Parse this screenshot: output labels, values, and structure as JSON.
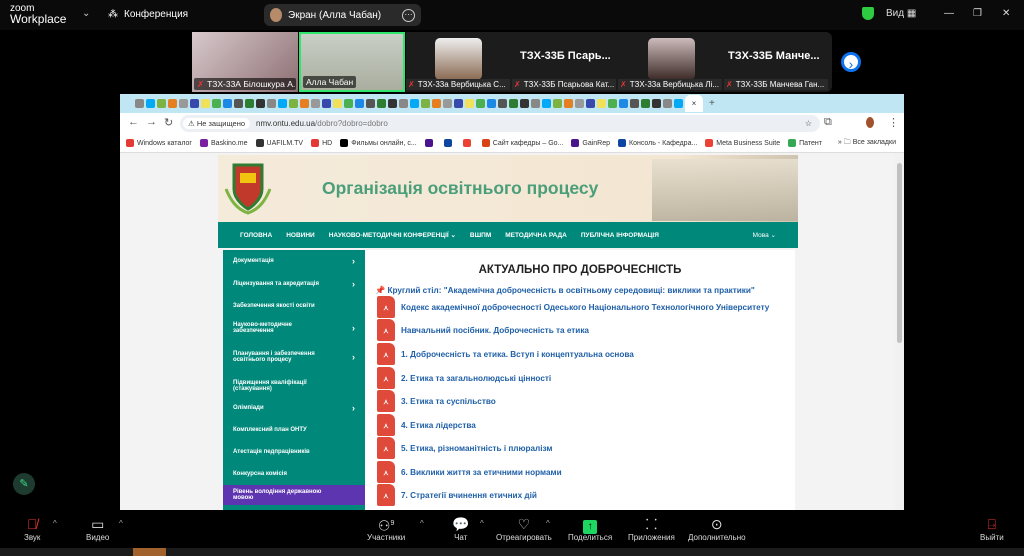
{
  "zoom": {
    "logo_top": "zoom",
    "logo_bottom": "Workplace",
    "meeting_label": "Конференция",
    "share_pill": "Экран (Алла Чабан)",
    "view_label": "Вид",
    "colors": {
      "speaker_border": "#2ee66b",
      "shield": "#2ecc40",
      "share": "#1ed760"
    }
  },
  "participants": [
    {
      "name": "ТЗХ-33А Білошкура А...",
      "muted": true
    },
    {
      "name": "Алла Чабан",
      "muted": false,
      "active": true
    },
    {
      "name": "ТЗХ-33а Вербицька С...",
      "muted": true
    },
    {
      "name": "ТЗХ-33Б Псарьова Кат...",
      "muted": true,
      "display": "ТЗХ-33Б  Псарь..."
    },
    {
      "name": "ТЗХ-33а Вербицька Лі...",
      "muted": true
    },
    {
      "name": "ТЗХ-33Б Манчева Ган...",
      "muted": true,
      "display": "ТЗХ-33Б  Манче..."
    }
  ],
  "browser": {
    "security": "Не защищено",
    "url_host": "nmv.ontu.edu.ua",
    "url_path": "/dobro?dobro=dobro",
    "bookmarks": [
      "Windows каталог",
      "Baskino.me",
      "UAFILM.TV",
      "HD",
      "Фильмы онлайн, с...",
      "Сайт кафедры – Go...",
      "GainRep",
      "Консоль - Кафедра...",
      "Meta Business Suite",
      "Патент"
    ],
    "all_bookmarks": "Все закладки"
  },
  "site": {
    "title": "Організація освітнього процесу",
    "nav": [
      "ГОЛОВНА",
      "НОВИНИ",
      "НАУКОВО-МЕТОДИЧНІ КОНФЕРЕНЦІЇ ⌄",
      "ВШПМ",
      "МЕТОДИЧНА РАДА",
      "ПУБЛІЧНА ІНФОРМАЦІЯ"
    ],
    "lang": "Мова ⌄",
    "sidebar": [
      {
        "label": "Документація",
        "sub": true
      },
      {
        "label": "Ліцензування та акредитація",
        "sub": true
      },
      {
        "label": "Забезпечення якості освіти",
        "sub": false
      },
      {
        "label": "Науково-методичне забезпечення",
        "sub": true
      },
      {
        "label": "Планування і забезпечення освітнього процесу",
        "sub": true
      },
      {
        "label": "Підвищення кваліфікації (стажування)",
        "sub": false
      },
      {
        "label": "Олімпіади",
        "sub": true
      },
      {
        "label": "Комплексний план ОНТУ",
        "sub": false
      },
      {
        "label": "Атестація педпрацівників",
        "sub": false
      },
      {
        "label": "Конкурсна комісія",
        "sub": false
      },
      {
        "label": "Рівень володіння державною мовою",
        "sub": false,
        "active": true
      }
    ],
    "heading": "АКТУАЛЬНО ПРО ДОБРОЧЕСНІСТЬ",
    "pinned": "Круглий стіл: \"Академічна доброчесність в освітньому середовищі: виклики та практики\"",
    "docs": [
      "Кодекс академічної доброчесності Одеського Національного Технологічного Університету",
      "Навчальний посібник. Доброчесність та етика",
      "1. Доброчесність та етика. Вступ і концептуальна основа",
      "2. Етика та загальнолюдські цінності",
      "3. Етика та суспільство",
      "4. Етика лідерства",
      "5. Етика, різноманітність і плюралізм",
      "6. Виклики життя за етичними нормами",
      "7. Стратегії вчинення етичних дій"
    ],
    "colors": {
      "teal": "#00897b",
      "active": "#5e35b1",
      "link": "#2060a8",
      "title": "#4a9e79"
    }
  },
  "toolbar": {
    "audio": "Звук",
    "video": "Видео",
    "participants": "Участники",
    "participants_count": "9",
    "chat": "Чат",
    "react": "Отреагировать",
    "share": "Поделиться",
    "apps": "Приложения",
    "more": "Дополнительно",
    "leave": "Выйти"
  }
}
